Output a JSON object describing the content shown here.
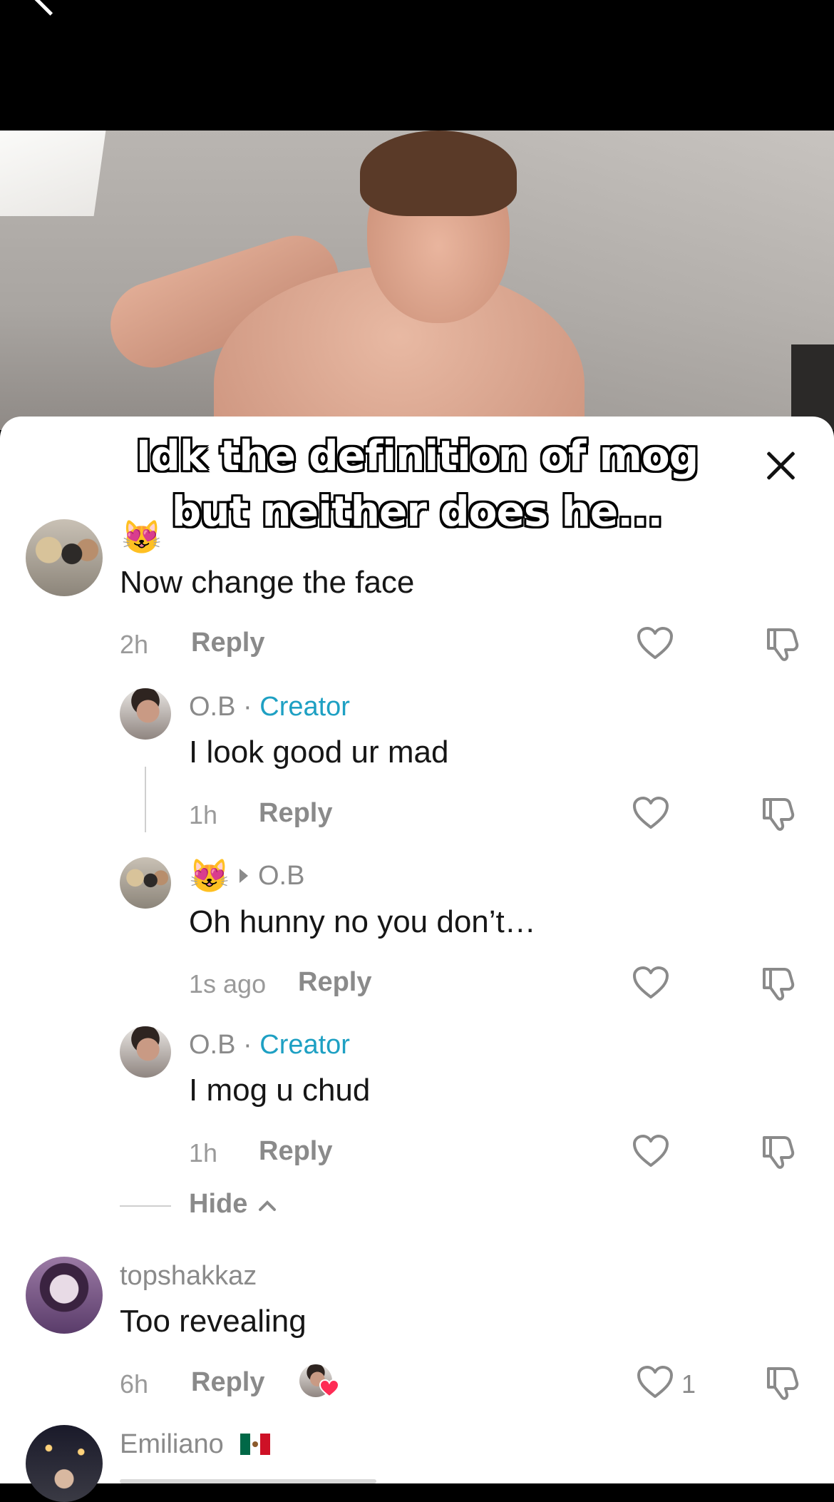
{
  "video": {
    "caption": "Idk the definition of mog but neither does he..."
  },
  "comments": [
    {
      "username_emoji": "😻",
      "text": "Now change the face",
      "time": "2h",
      "reply_label": "Reply",
      "replies": [
        {
          "username": "O.B",
          "separator": "·",
          "badge": "Creator",
          "text": "I look good ur mad",
          "time": "1h",
          "reply_label": "Reply"
        },
        {
          "username_emoji": "😻",
          "reply_to": "O.B",
          "text": "Oh hunny no you don’t…",
          "time": "1s ago",
          "reply_label": "Reply"
        },
        {
          "username": "O.B",
          "separator": "·",
          "badge": "Creator",
          "text": "I mog u chud",
          "time": "1h",
          "reply_label": "Reply"
        }
      ],
      "hide_label": "Hide"
    },
    {
      "username": "topshakkaz",
      "text": "Too revealing",
      "time": "6h",
      "reply_label": "Reply",
      "likes": "1"
    },
    {
      "username": "Emiliano"
    }
  ],
  "colors": {
    "creator": "#1ea0c3",
    "like_heart_badge": "#fe2c55"
  }
}
